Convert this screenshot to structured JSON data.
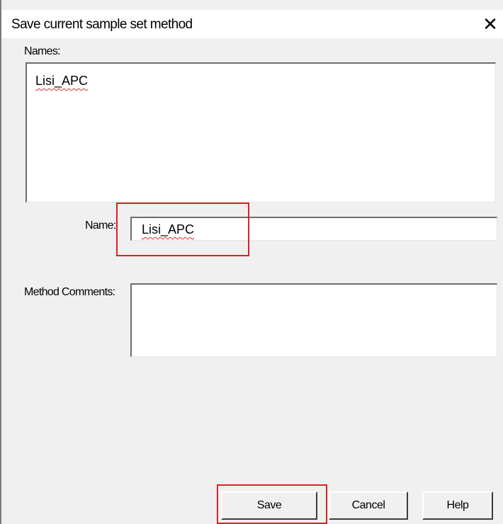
{
  "dialog": {
    "title": "Save current sample set method",
    "close_glyph": "✕"
  },
  "names": {
    "label": "Names:",
    "items": [
      "Lisi_APC"
    ]
  },
  "name_field": {
    "label": "Name:",
    "value": "Lisi_APC"
  },
  "comments": {
    "label": "Method Comments:",
    "value": ""
  },
  "buttons": {
    "save": "Save",
    "cancel": "Cancel",
    "help": "Help"
  },
  "colors": {
    "highlight": "#e02020",
    "spellcheck_underline": "#d23030"
  },
  "icons": {
    "close": "close-icon"
  }
}
